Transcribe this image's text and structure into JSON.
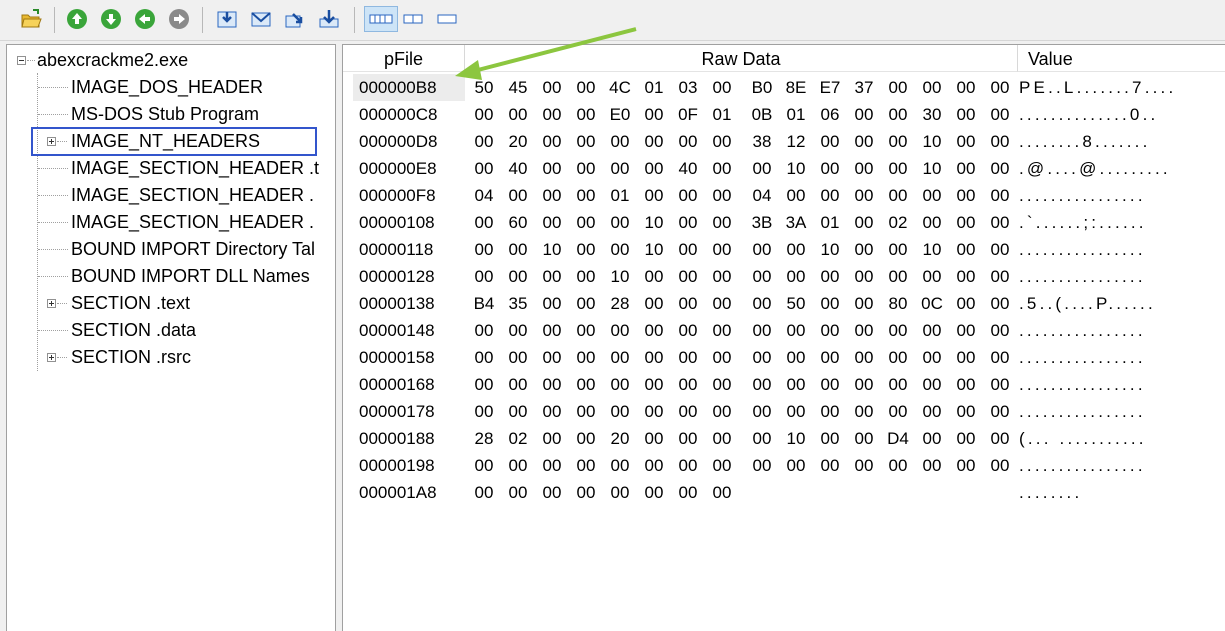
{
  "toolbar": {
    "buttons": [
      {
        "name": "open-file",
        "icon": "folder-open-icon"
      },
      {
        "name": "nav-up",
        "icon": "arrow-up-circle-icon"
      },
      {
        "name": "nav-down",
        "icon": "arrow-down-circle-icon"
      },
      {
        "name": "nav-back",
        "icon": "arrow-left-circle-icon"
      },
      {
        "name": "nav-forward",
        "icon": "arrow-right-circle-icon"
      },
      {
        "name": "view-1",
        "icon": "import-icon"
      },
      {
        "name": "view-2",
        "icon": "envelope-icon"
      },
      {
        "name": "view-3",
        "icon": "export-icon"
      },
      {
        "name": "view-4",
        "icon": "download-icon"
      },
      {
        "name": "layout-wide",
        "icon": "layout-wide-icon"
      },
      {
        "name": "layout-medium",
        "icon": "layout-medium-icon"
      },
      {
        "name": "layout-narrow",
        "icon": "layout-narrow-icon"
      }
    ]
  },
  "tree": {
    "root": "abexcrackme2.exe",
    "items": [
      {
        "label": "IMAGE_DOS_HEADER",
        "expander": "none"
      },
      {
        "label": "MS-DOS Stub Program",
        "expander": "none"
      },
      {
        "label": "IMAGE_NT_HEADERS",
        "expander": "plus",
        "highlighted": true
      },
      {
        "label": "IMAGE_SECTION_HEADER .t",
        "expander": "none"
      },
      {
        "label": "IMAGE_SECTION_HEADER .",
        "expander": "none"
      },
      {
        "label": "IMAGE_SECTION_HEADER .",
        "expander": "none"
      },
      {
        "label": "BOUND IMPORT Directory Tal",
        "expander": "none"
      },
      {
        "label": "BOUND IMPORT DLL Names",
        "expander": "none"
      },
      {
        "label": "SECTION .text",
        "expander": "plus"
      },
      {
        "label": "SECTION .data",
        "expander": "none"
      },
      {
        "label": "SECTION .rsrc",
        "expander": "plus"
      }
    ]
  },
  "grid": {
    "headers": {
      "pfile": "pFile",
      "raw": "Raw Data",
      "value": "Value"
    },
    "rows": [
      {
        "pfile": "000000B8",
        "bytes": [
          "50",
          "45",
          "00",
          "00",
          "4C",
          "01",
          "03",
          "00",
          "B0",
          "8E",
          "E7",
          "37",
          "00",
          "00",
          "00",
          "00"
        ],
        "value": "PE..L.......7...."
      },
      {
        "pfile": "000000C8",
        "bytes": [
          "00",
          "00",
          "00",
          "00",
          "E0",
          "00",
          "0F",
          "01",
          "0B",
          "01",
          "06",
          "00",
          "00",
          "30",
          "00",
          "00"
        ],
        "value": "..............0.."
      },
      {
        "pfile": "000000D8",
        "bytes": [
          "00",
          "20",
          "00",
          "00",
          "00",
          "00",
          "00",
          "00",
          "38",
          "12",
          "00",
          "00",
          "00",
          "10",
          "00",
          "00"
        ],
        "value": "........8......."
      },
      {
        "pfile": "000000E8",
        "bytes": [
          "00",
          "40",
          "00",
          "00",
          "00",
          "00",
          "40",
          "00",
          "00",
          "10",
          "00",
          "00",
          "00",
          "10",
          "00",
          "00"
        ],
        "value": ".@....@........."
      },
      {
        "pfile": "000000F8",
        "bytes": [
          "04",
          "00",
          "00",
          "00",
          "01",
          "00",
          "00",
          "00",
          "04",
          "00",
          "00",
          "00",
          "00",
          "00",
          "00",
          "00"
        ],
        "value": "................"
      },
      {
        "pfile": "00000108",
        "bytes": [
          "00",
          "60",
          "00",
          "00",
          "00",
          "10",
          "00",
          "00",
          "3B",
          "3A",
          "01",
          "00",
          "02",
          "00",
          "00",
          "00"
        ],
        "value": ".`......;:......"
      },
      {
        "pfile": "00000118",
        "bytes": [
          "00",
          "00",
          "10",
          "00",
          "00",
          "10",
          "00",
          "00",
          "00",
          "00",
          "10",
          "00",
          "00",
          "10",
          "00",
          "00"
        ],
        "value": "................"
      },
      {
        "pfile": "00000128",
        "bytes": [
          "00",
          "00",
          "00",
          "00",
          "10",
          "00",
          "00",
          "00",
          "00",
          "00",
          "00",
          "00",
          "00",
          "00",
          "00",
          "00"
        ],
        "value": "................"
      },
      {
        "pfile": "00000138",
        "bytes": [
          "B4",
          "35",
          "00",
          "00",
          "28",
          "00",
          "00",
          "00",
          "00",
          "50",
          "00",
          "00",
          "80",
          "0C",
          "00",
          "00"
        ],
        "value": ".5..(....P......"
      },
      {
        "pfile": "00000148",
        "bytes": [
          "00",
          "00",
          "00",
          "00",
          "00",
          "00",
          "00",
          "00",
          "00",
          "00",
          "00",
          "00",
          "00",
          "00",
          "00",
          "00"
        ],
        "value": "................"
      },
      {
        "pfile": "00000158",
        "bytes": [
          "00",
          "00",
          "00",
          "00",
          "00",
          "00",
          "00",
          "00",
          "00",
          "00",
          "00",
          "00",
          "00",
          "00",
          "00",
          "00"
        ],
        "value": "................"
      },
      {
        "pfile": "00000168",
        "bytes": [
          "00",
          "00",
          "00",
          "00",
          "00",
          "00",
          "00",
          "00",
          "00",
          "00",
          "00",
          "00",
          "00",
          "00",
          "00",
          "00"
        ],
        "value": "................"
      },
      {
        "pfile": "00000178",
        "bytes": [
          "00",
          "00",
          "00",
          "00",
          "00",
          "00",
          "00",
          "00",
          "00",
          "00",
          "00",
          "00",
          "00",
          "00",
          "00",
          "00"
        ],
        "value": "................"
      },
      {
        "pfile": "00000188",
        "bytes": [
          "28",
          "02",
          "00",
          "00",
          "20",
          "00",
          "00",
          "00",
          "00",
          "10",
          "00",
          "00",
          "D4",
          "00",
          "00",
          "00"
        ],
        "value": "(... ..........."
      },
      {
        "pfile": "00000198",
        "bytes": [
          "00",
          "00",
          "00",
          "00",
          "00",
          "00",
          "00",
          "00",
          "00",
          "00",
          "00",
          "00",
          "00",
          "00",
          "00",
          "00"
        ],
        "value": "................"
      },
      {
        "pfile": "000001A8",
        "bytes": [
          "00",
          "00",
          "00",
          "00",
          "00",
          "00",
          "00",
          "00"
        ],
        "value": "........"
      }
    ]
  },
  "colors": {
    "highlight_border": "#3355cc",
    "arrow": "#8cc63f",
    "selected_row": "#ececec"
  }
}
